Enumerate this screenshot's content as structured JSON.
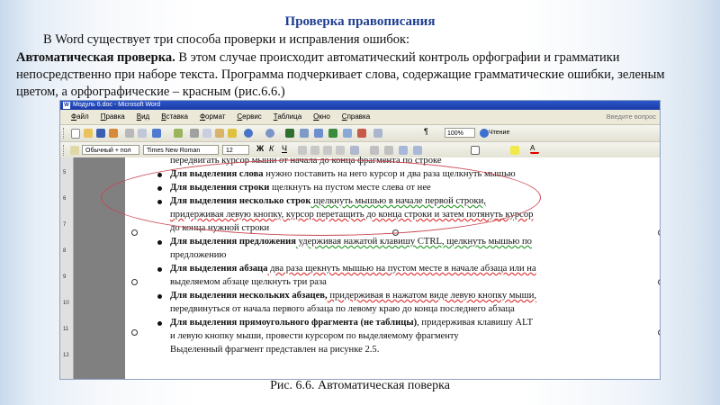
{
  "slide": {
    "title": "Проверка правописания",
    "intro": "В Word существует три способа проверки и исправления ошибок:",
    "para_bold": "Автоматическая проверка.",
    "para_text": " В этом случае происходит автоматический контроль орфографии и грамматики непосредственно при наборе текста. Программа подчеркивает слова, содержащие грамматические ошибки, зеленым цветом, а орфографические – красным (рис.6.6.)",
    "caption": "Рис. 6.6. Автоматическая поверка"
  },
  "word_window": {
    "title": "Модуль 6.doc - Microsoft Word",
    "menu": [
      "Файл",
      "Правка",
      "Вид",
      "Вставка",
      "Формат",
      "Сервис",
      "Таблица",
      "Окно",
      "Справка"
    ],
    "help_box": "Введите вопрос",
    "zoom": "100%",
    "read_button": "Чтение",
    "style": "Обычный + пол",
    "font": "Times New Roman",
    "size": "12",
    "ruler_numbers": [
      "1",
      "2",
      "1",
      "1",
      "2",
      "3",
      "4",
      "5",
      "6",
      "7",
      "8",
      "9",
      "10",
      "11",
      "12",
      "13",
      "14",
      "15",
      "16",
      "17"
    ],
    "vruler_numbers": [
      "5",
      "6",
      "7",
      "8",
      "9",
      "10",
      "11",
      "12"
    ]
  },
  "doc_lines": [
    {
      "t": "передвигать курсор мыши от начала до конца фрагмента по строке"
    },
    {
      "b": "Для выделения слова",
      "t": " нужно поставить на него курсор и два раза щелкнуть мышью"
    },
    {
      "b": "Для выделения строки",
      "t": "  щелкнуть на пустом месте слева от нее"
    },
    {
      "b": "Для выделения несколько строк",
      "t": " щелкнуть мышью в начале первой строки,"
    },
    {
      "t": "придерживая левую кнопку, курсор перетащить до конца строки и затем потянуть курсор"
    },
    {
      "t": "до конца нужной строки"
    },
    {
      "b": "Для выделения предложения",
      "t": "  удерживая нажатой клавишу CTRL, щелкнуть мышью по"
    },
    {
      "t": "предложению"
    },
    {
      "b": "Для выделения абзаца",
      "t": " два раза щекнуть мышью на пустом месте в начале абзаца или на"
    },
    {
      "t": "выделяемом абзаце щелкнуть три раза"
    },
    {
      "b": "Для выделения нескольких абзацев,",
      "t": " придерживая в нажатом виде левую кнопку мыши,"
    },
    {
      "t": "передвинуться от начала первого абзаца по левому краю до конца последнего абзаца"
    },
    {
      "b": "Для выделения прямоугольного фрагмента (не таблицы)",
      "t": ", придерживая клавишу ALT"
    },
    {
      "t": "и левую кнопку мыши, провести курсором по выделяемому фрагменту"
    },
    {
      "t": "Выделенный фрагмент представлен на рисунке 2.5."
    }
  ],
  "colors": {
    "title_blue": "#1f3e92",
    "ellipse_red": "#c8434f",
    "titlebar_blue": "#2b56c8"
  }
}
